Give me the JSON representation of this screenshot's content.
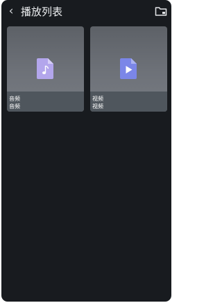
{
  "header": {
    "back_icon": "back-arrow-icon",
    "title": "播放列表",
    "folder_icon": "folder-icon"
  },
  "playlists": [
    {
      "name": "音频",
      "subtitle": "音频",
      "icon": "music-file-icon",
      "icon_color": "#b3a6ec"
    },
    {
      "name": "视频",
      "subtitle": "视频",
      "icon": "video-file-icon",
      "icon_color": "#7b86e8"
    }
  ],
  "colors": {
    "background": "#181b1f",
    "text": "#eef0f2",
    "card": "#6b6f76",
    "label_strip": "#4f565d"
  }
}
